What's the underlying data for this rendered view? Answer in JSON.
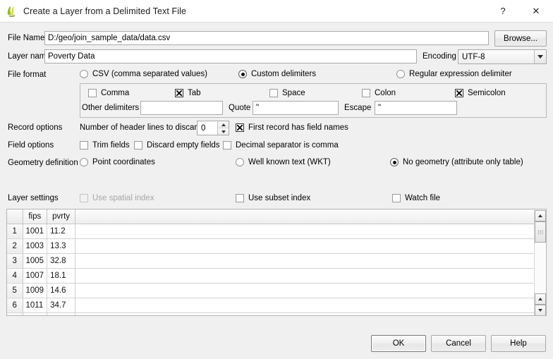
{
  "window": {
    "title": "Create a Layer from a Delimited Text File",
    "icon": "qgis-logo-icon",
    "help_button": "?",
    "close_button": "✕"
  },
  "file": {
    "label": "File Name",
    "value": "D:/geo/join_sample_data/data.csv",
    "placeholder": "",
    "browse_label": "Browse..."
  },
  "layer": {
    "label": "Layer name",
    "value": "Poverty Data",
    "placeholder": "",
    "encoding_label": "Encoding",
    "encoding_value": "UTF-8"
  },
  "file_format": {
    "label": "File format",
    "options": [
      {
        "label": "CSV (comma separated values)",
        "selected": false
      },
      {
        "label": "Custom delimiters",
        "selected": true
      },
      {
        "label": "Regular expression delimiter",
        "selected": false
      }
    ]
  },
  "delimiters": {
    "checkboxes": [
      {
        "label": "Comma",
        "checked": false
      },
      {
        "label": "Tab",
        "checked": true
      },
      {
        "label": "Space",
        "checked": false
      },
      {
        "label": "Colon",
        "checked": false
      },
      {
        "label": "Semicolon",
        "checked": true
      }
    ],
    "other_label": "Other delimiters",
    "other_value": "",
    "quote_label": "Quote",
    "quote_value": "\"",
    "escape_label": "Escape",
    "escape_value": "\""
  },
  "record_options": {
    "label": "Record options",
    "header_lines_label": "Number of header lines to discard",
    "header_lines_value": "0",
    "first_record_label": "First record has field names",
    "first_record_checked": true
  },
  "field_options": {
    "label": "Field options",
    "items": [
      {
        "label": "Trim fields",
        "checked": false
      },
      {
        "label": "Discard empty fields",
        "checked": false
      },
      {
        "label": "Decimal separator is comma",
        "checked": false
      }
    ]
  },
  "geometry": {
    "label": "Geometry definition",
    "options": [
      {
        "label": "Point coordinates",
        "selected": false
      },
      {
        "label": "Well known text (WKT)",
        "selected": false
      },
      {
        "label": "No geometry (attribute only table)",
        "selected": true
      }
    ]
  },
  "layer_settings": {
    "label": "Layer settings",
    "items": [
      {
        "label": "Use spatial index",
        "checked": false,
        "disabled": true
      },
      {
        "label": "Use subset index",
        "checked": false,
        "disabled": false
      },
      {
        "label": "Watch file",
        "checked": false,
        "disabled": false
      }
    ]
  },
  "preview_table": {
    "columns": [
      "fips",
      "pvrty"
    ],
    "rows": [
      {
        "n": "1",
        "fips": "1001",
        "pvrty": "11.2"
      },
      {
        "n": "2",
        "fips": "1003",
        "pvrty": "13.3"
      },
      {
        "n": "3",
        "fips": "1005",
        "pvrty": "32.8"
      },
      {
        "n": "4",
        "fips": "1007",
        "pvrty": "18.1"
      },
      {
        "n": "5",
        "fips": "1009",
        "pvrty": "14.6"
      },
      {
        "n": "6",
        "fips": "1011",
        "pvrty": "34.7"
      }
    ]
  },
  "footer": {
    "ok": "OK",
    "cancel": "Cancel",
    "help": "Help"
  }
}
